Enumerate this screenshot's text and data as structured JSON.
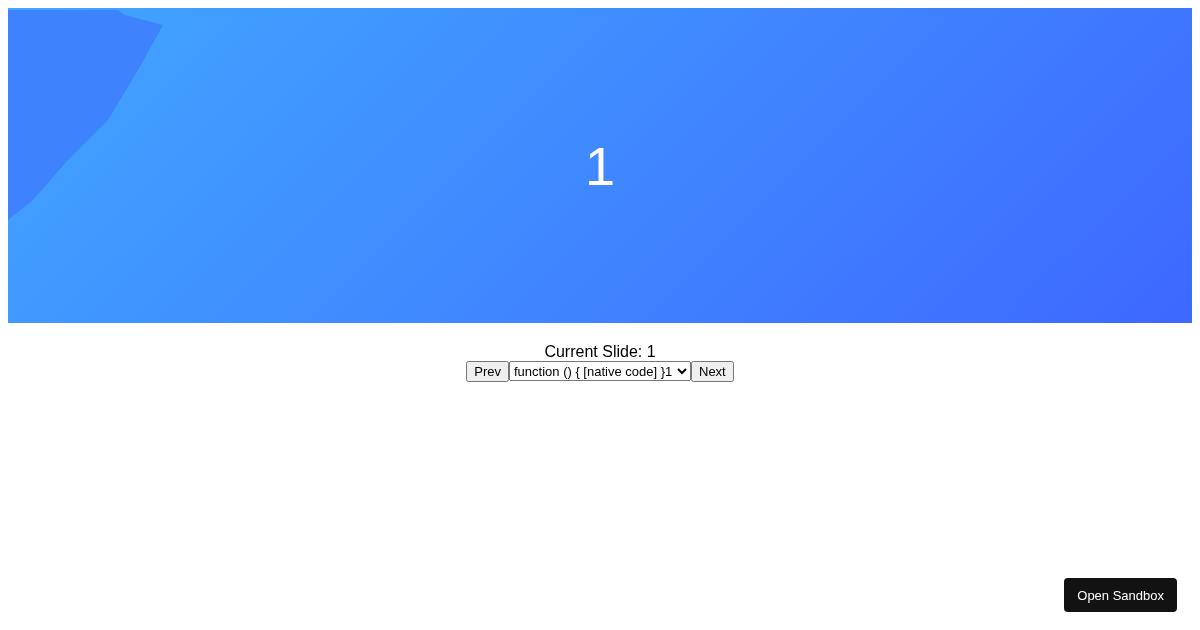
{
  "slide": {
    "number": "1"
  },
  "status": {
    "label": "Current Slide: 1"
  },
  "controls": {
    "prev": "Prev",
    "select_value": "function () { [native code] }1",
    "next": "Next"
  },
  "open_sandbox": "Open Sandbox"
}
